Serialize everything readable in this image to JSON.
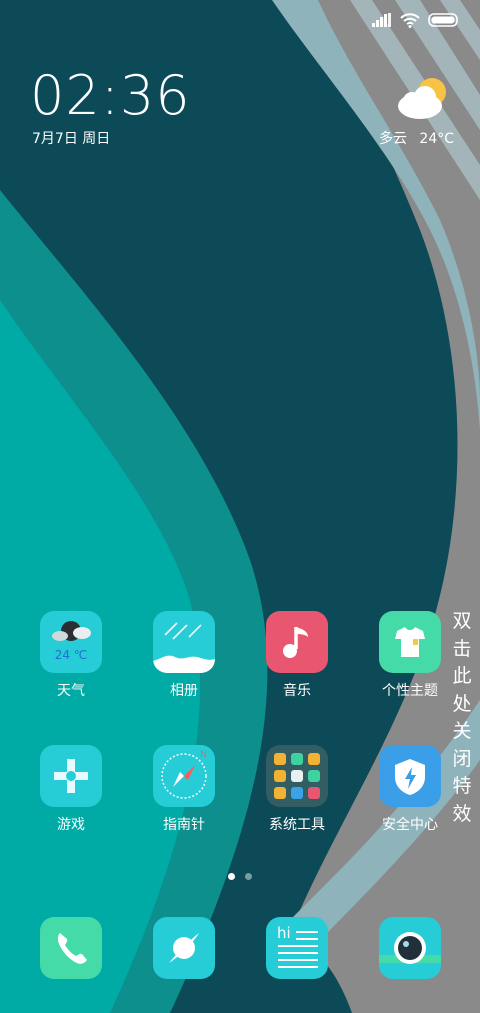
{
  "status_bar": {
    "signal_icon": "cellular-signal-icon",
    "wifi_icon": "wifi-icon",
    "battery_icon": "battery-icon"
  },
  "clock": {
    "time": "02:36",
    "date": "7月7日 周日"
  },
  "weather_widget": {
    "icon": "partly-cloudy-icon",
    "condition": "多云",
    "temperature": "24°C"
  },
  "apps": [
    {
      "label": "天气",
      "icon": "weather-icon",
      "badge_text": "24 ℃"
    },
    {
      "label": "相册",
      "icon": "gallery-icon"
    },
    {
      "label": "音乐",
      "icon": "music-icon"
    },
    {
      "label": "个性主题",
      "icon": "themes-icon"
    },
    {
      "label": "游戏",
      "icon": "games-icon"
    },
    {
      "label": "指南针",
      "icon": "compass-icon",
      "compass_n": "N"
    },
    {
      "label": "系统工具",
      "icon": "system-tools-folder-icon"
    },
    {
      "label": "安全中心",
      "icon": "security-center-icon"
    }
  ],
  "dock": [
    {
      "icon": "phone-icon"
    },
    {
      "icon": "browser-icon"
    },
    {
      "icon": "notes-icon",
      "text": "hi"
    },
    {
      "icon": "camera-icon"
    }
  ],
  "side_text": [
    "双",
    "击",
    "此",
    "处",
    "关",
    "闭",
    "特",
    "效"
  ],
  "page_indicator": {
    "current": 1,
    "total": 2
  },
  "colors": {
    "wall_dark": "#0d4a58",
    "wall_teal": "#00aba5",
    "wall_grey": "#8a8a8a",
    "wall_light_band": "#8fb3bb",
    "icon_cyan": "#26ccd6",
    "music_pink": "#e9566f",
    "theme_green": "#45dba9",
    "security_blue": "#3a9fe8"
  }
}
